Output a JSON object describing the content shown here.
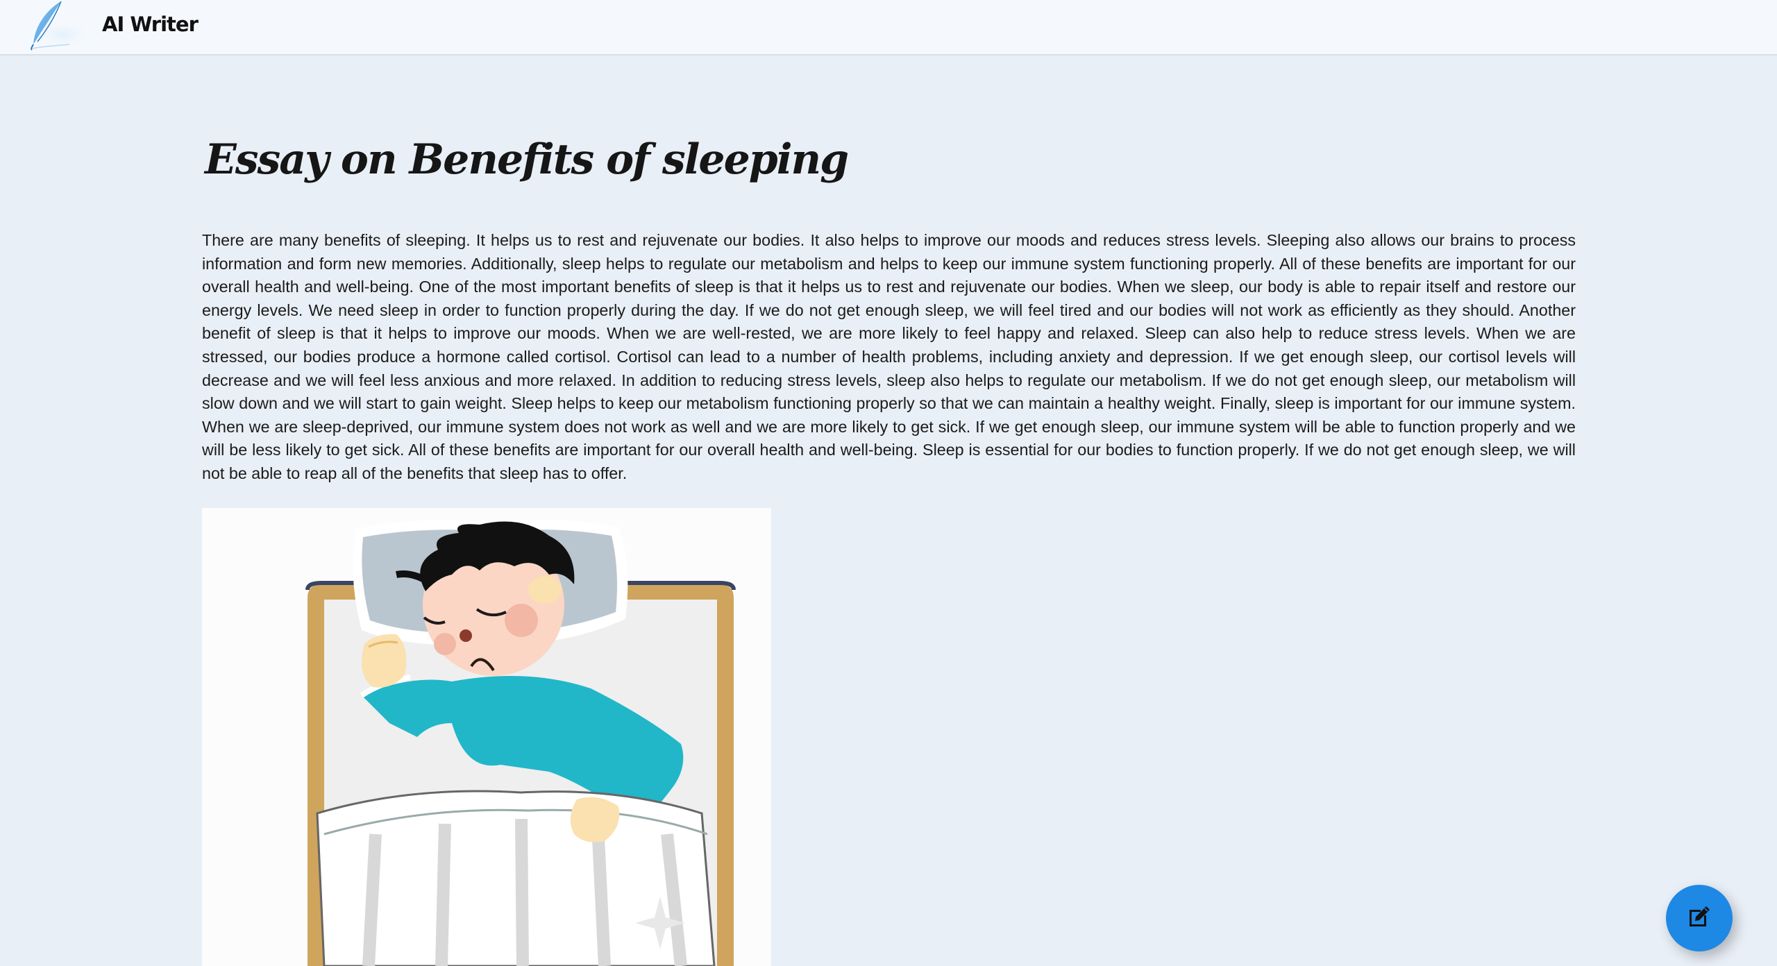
{
  "header": {
    "app_name": "AI Writer",
    "logo_icon": "feather-quill-icon"
  },
  "article": {
    "title": "Essay on Benefits of sleeping",
    "body": "There are many benefits of sleeping. It helps us to rest and rejuvenate our bodies. It also helps to improve our moods and reduces stress levels. Sleeping also allows our brains to process information and form new memories. Additionally, sleep helps to regulate our metabolism and helps to keep our immune system functioning properly. All of these benefits are important for our overall health and well-being. One of the most important benefits of sleep is that it helps us to rest and rejuvenate our bodies. When we sleep, our body is able to repair itself and restore our energy levels. We need sleep in order to function properly during the day. If we do not get enough sleep, we will feel tired and our bodies will not work as efficiently as they should. Another benefit of sleep is that it helps to improve our moods. When we are well-rested, we are more likely to feel happy and relaxed. Sleep can also help to reduce stress levels. When we are stressed, our bodies produce a hormone called cortisol. Cortisol can lead to a number of health problems, including anxiety and depression. If we get enough sleep, our cortisol levels will decrease and we will feel less anxious and more relaxed. In addition to reducing stress levels, sleep also helps to regulate our metabolism. If we do not get enough sleep, our metabolism will slow down and we will start to gain weight. Sleep helps to keep our metabolism functioning properly so that we can maintain a healthy weight. Finally, sleep is important for our immune system. When we are sleep-deprived, our immune system does not work as well and we are more likely to get sick. If we get enough sleep, our immune system will be able to function properly and we will be less likely to get sick. All of these benefits are important for our overall health and well-being. Sleep is essential for our bodies to function properly. If we do not get enough sleep, we will not be able to reap all of the benefits that sleep has to offer.",
    "illustration_icon": "sleeping-boy-illustration"
  },
  "fab": {
    "icon": "edit-icon",
    "color": "#1e88e5"
  },
  "colors": {
    "background": "#e9eff6",
    "header_background": "#f5f9fd",
    "accent": "#1e88e5"
  }
}
